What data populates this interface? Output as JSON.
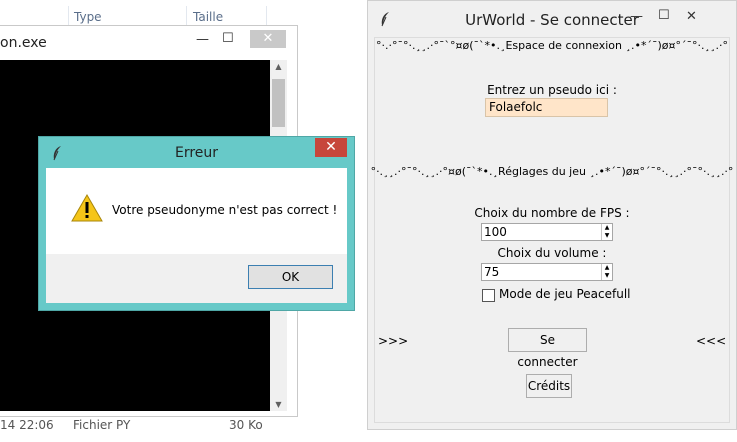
{
  "explorer": {
    "columns": [
      "Type",
      "Taille"
    ],
    "status_row": {
      "date": "14 22:06",
      "type": "Fichier PY",
      "size": "30 Ko"
    }
  },
  "console_window": {
    "title": "on.exe",
    "controls": {
      "minimize": "—",
      "maximize": "☐",
      "close": "✕"
    }
  },
  "error_dialog": {
    "title": "Erreur",
    "message": "Votre pseudonyme n'est pas correct !",
    "ok_label": "OK",
    "close_label": "✕"
  },
  "urworld": {
    "title": "UrWorld - Se connecter",
    "controls": {
      "minimize": "—",
      "maximize": "☐",
      "close": "✕"
    },
    "login_header": "°·.·°¯°·.¸¸.·°¯`°¤ø(¯`*•.¸Espace de connexion ¸.•*´¯)ø¤°´¯°·.¸¸.·°",
    "pseudo_label": "Entrez un pseudo ici :",
    "pseudo_value": "Folaefolc",
    "settings_header": "°·.¸¸.·°¯°·.¸¸.·°¤ø(¯`*•.¸Réglages du jeu ¸.•*´¯)ø¤°´¯°·.¸¸.·°¯°·.¸¸.·°",
    "fps_label": "Choix du nombre de FPS :",
    "fps_value": "100",
    "volume_label": "Choix du volume :",
    "volume_value": "75",
    "peaceful_label": "Mode de jeu Peacefull",
    "peaceful_checked": false,
    "left_arrows": ">>>",
    "right_arrows": "<<<",
    "connect_label": "Se connecter",
    "credits_label": "Crédits"
  }
}
